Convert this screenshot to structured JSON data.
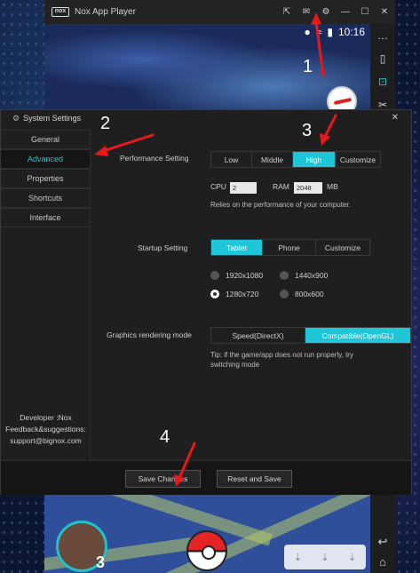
{
  "nox": {
    "logo": "nox",
    "title": "Nox App Player",
    "controls": [
      "⇱",
      "✉",
      "⚙",
      "—",
      "☐",
      "✕"
    ],
    "status_time": "10:16",
    "sidebar_tools": [
      "…",
      "▯",
      "⊡",
      "✂"
    ],
    "nav_back": "↩",
    "nav_home": "⌂"
  },
  "game": {
    "level": "3",
    "nearby": [
      "⇣",
      "⇣",
      "⇣"
    ]
  },
  "dialog": {
    "title": "System Settings",
    "close": "✕",
    "nav": [
      {
        "label": "General",
        "selected": false
      },
      {
        "label": "Advanced",
        "selected": true
      },
      {
        "label": "Properties",
        "selected": false
      },
      {
        "label": "Shortcuts",
        "selected": false
      },
      {
        "label": "Interface",
        "selected": false
      }
    ],
    "developer_line1": "Developer :Nox",
    "developer_line2": "Feedback&suggestions:",
    "developer_line3": "support@bignox.com",
    "performance": {
      "label": "Performance Setting",
      "options": [
        "Low",
        "Middle",
        "High",
        "Customize"
      ],
      "selected": "High",
      "cpu_label": "CPU",
      "cpu_value": "2",
      "ram_label": "RAM",
      "ram_value": "2048",
      "ram_unit": "MB",
      "note": "Relies on the performance of your computer."
    },
    "startup": {
      "label": "Startup Setting",
      "options": [
        "Tablet",
        "Phone",
        "Customize"
      ],
      "selected": "Tablet",
      "resolutions": [
        "1920x1080",
        "1440x900",
        "1280x720",
        "800x600"
      ],
      "selected_resolution": "1280x720"
    },
    "graphics": {
      "label": "Graphics rendering mode",
      "options": [
        "Speed(DirectX)",
        "Compatible(OpenGL)"
      ],
      "selected": "Compatible(OpenGL)",
      "tip_line1": "Tip: if the game/app does not run properly, try",
      "tip_line2": "switching mode"
    },
    "save_button": "Save Changes",
    "reset_button": "Reset and Save"
  },
  "annotations": [
    "1",
    "2",
    "3",
    "4"
  ],
  "annotation_color": "#e8181c",
  "accent_color": "#1ec6d8"
}
